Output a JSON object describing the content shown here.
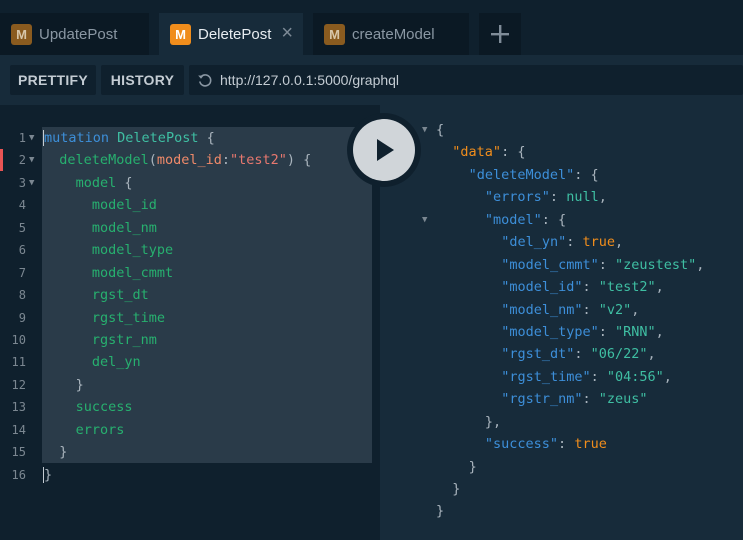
{
  "tabs": [
    {
      "badge": "M",
      "label": "UpdatePost"
    },
    {
      "badge": "M",
      "label": "DeletePost",
      "close": "×"
    },
    {
      "badge": "M",
      "label": "createModel"
    }
  ],
  "toolbar": {
    "prettify_label": "PRETTIFY",
    "history_label": "HISTORY",
    "url": "http://127.0.0.1:5000/graphql"
  },
  "editor": {
    "line_numbers": [
      "1",
      "2",
      "3",
      "4",
      "5",
      "6",
      "7",
      "8",
      "9",
      "10",
      "11",
      "12",
      "13",
      "14",
      "15",
      "16"
    ],
    "lines": [
      {
        "kw": "mutation",
        "name": "DeletePost",
        "tail": " {"
      },
      {
        "fn": "deleteModel",
        "arg": "model_id",
        "val": "\"test2\"",
        "tail": ") {"
      },
      {
        "field": "model",
        "tail": " {"
      },
      {
        "field": "model_id"
      },
      {
        "field": "model_nm"
      },
      {
        "field": "model_type"
      },
      {
        "field": "model_cmmt"
      },
      {
        "field": "rgst_dt"
      },
      {
        "field": "rgst_time"
      },
      {
        "field": "rgstr_nm"
      },
      {
        "field": "del_yn"
      },
      {
        "tail": "}"
      },
      {
        "field": "success"
      },
      {
        "field": "errors"
      },
      {
        "tail": "}"
      },
      {
        "tail": "}"
      }
    ]
  },
  "result": {
    "data_key": "\"data\"",
    "deleteModel_key": "\"deleteModel\"",
    "errors_key": "\"errors\"",
    "errors_val": "null",
    "model_key": "\"model\"",
    "fields": [
      {
        "key": "\"del_yn\"",
        "val": "true",
        "type": "bool"
      },
      {
        "key": "\"model_cmmt\"",
        "val": "\"zeustest\"",
        "type": "str"
      },
      {
        "key": "\"model_id\"",
        "val": "\"test2\"",
        "type": "str"
      },
      {
        "key": "\"model_nm\"",
        "val": "\"v2\"",
        "type": "str"
      },
      {
        "key": "\"model_type\"",
        "val": "\"RNN\"",
        "type": "str"
      },
      {
        "key": "\"rgst_dt\"",
        "val": "\"06/22\"",
        "type": "str"
      },
      {
        "key": "\"rgst_time\"",
        "val": "\"04:56\"",
        "type": "str"
      },
      {
        "key": "\"rgstr_nm\"",
        "val": "\"zeus\"",
        "type": "str"
      }
    ],
    "success_key": "\"success\"",
    "success_val": "true"
  },
  "colors": {
    "accent": "#f08d1c",
    "background": "#172b3a",
    "editor_bg": "#0f202d"
  }
}
